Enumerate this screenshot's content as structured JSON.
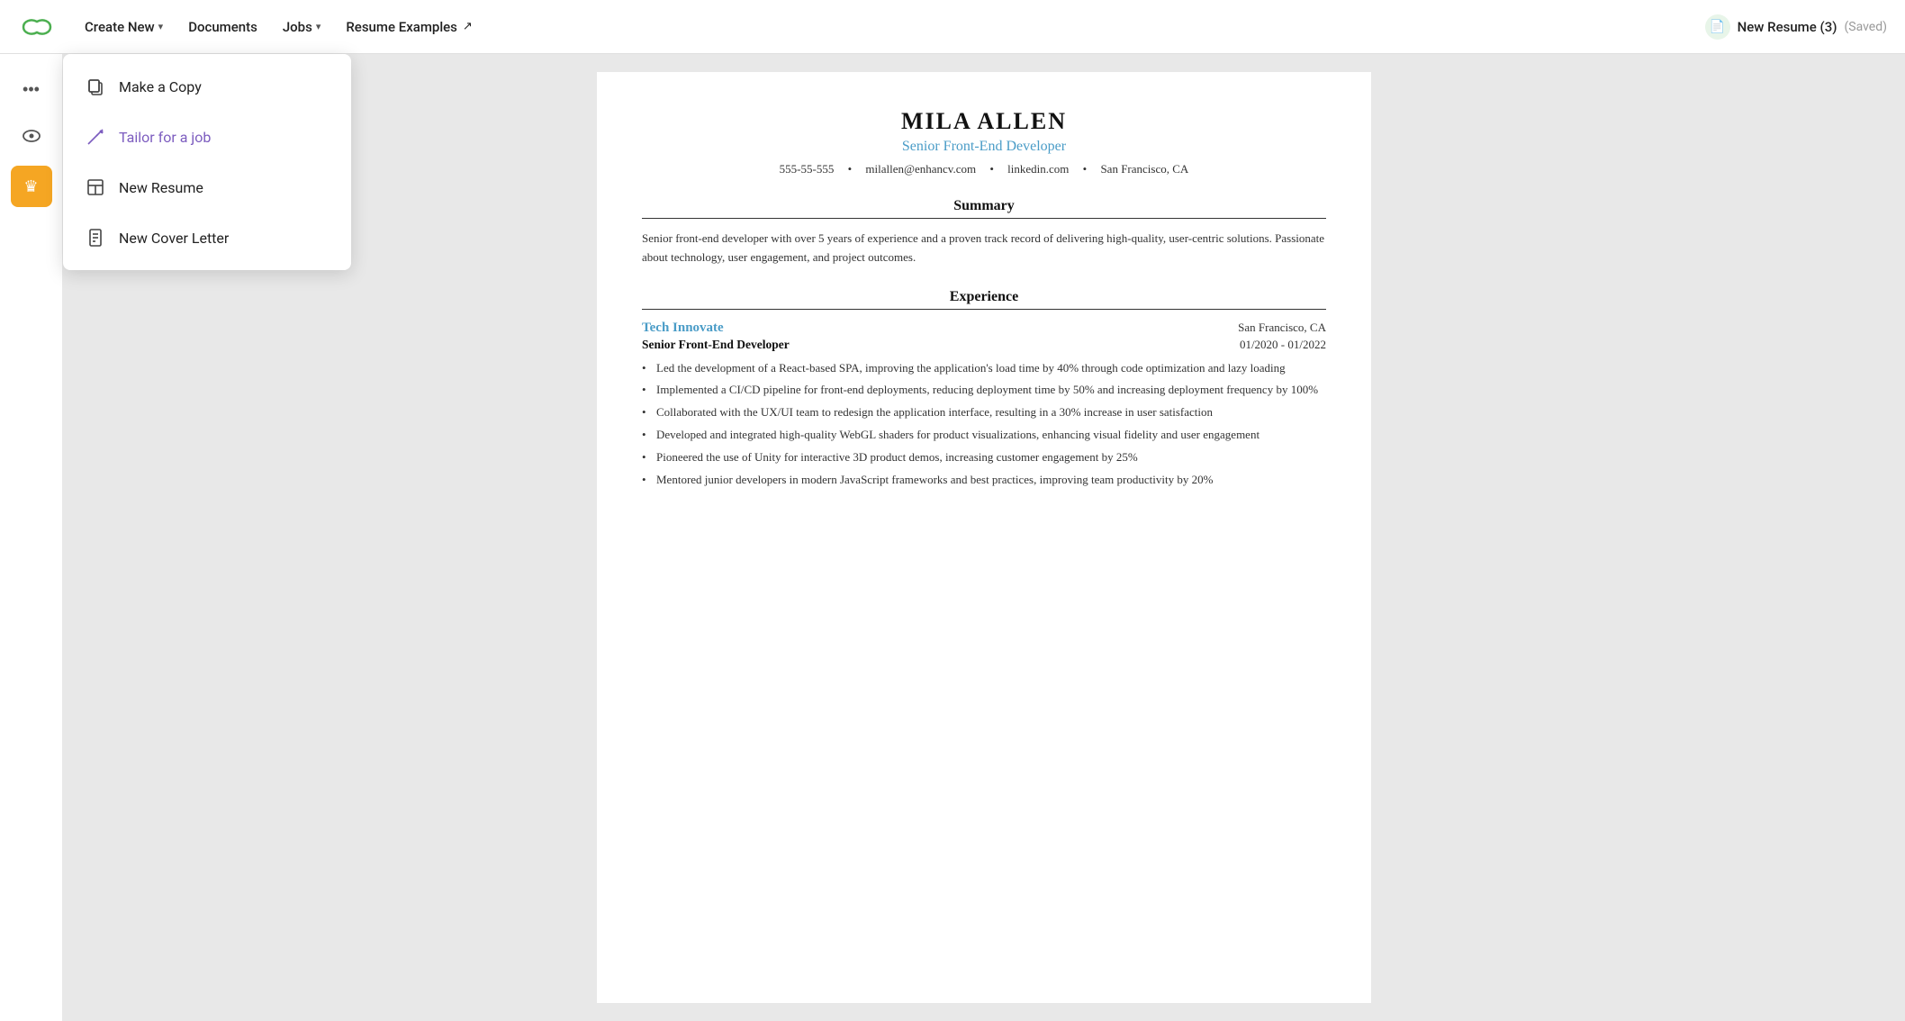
{
  "header": {
    "logo_alt": "Enhancv logo",
    "nav": [
      {
        "id": "create-new",
        "label": "Create New",
        "hasDropdown": true
      },
      {
        "id": "documents",
        "label": "Documents",
        "hasDropdown": false
      },
      {
        "id": "jobs",
        "label": "Jobs",
        "hasDropdown": true
      },
      {
        "id": "resume-examples",
        "label": "Resume Examples",
        "hasExternal": true
      }
    ],
    "resume_tab": {
      "name": "New Resume (3)",
      "saved_status": "(Saved)"
    }
  },
  "sidebar": {
    "buttons": [
      {
        "id": "more-options",
        "icon": "···",
        "label": "More options",
        "active": false
      },
      {
        "id": "preview",
        "icon": "👁",
        "label": "Preview",
        "active": false
      },
      {
        "id": "premium",
        "icon": "★",
        "label": "Premium",
        "active": true
      }
    ]
  },
  "dropdown": {
    "items": [
      {
        "id": "make-copy",
        "label": "Make a Copy",
        "icon": "copy",
        "highlighted": false
      },
      {
        "id": "tailor-job",
        "label": "Tailor for a job",
        "icon": "wand",
        "highlighted": true
      },
      {
        "id": "new-resume",
        "label": "New Resume",
        "icon": "layout",
        "highlighted": false
      },
      {
        "id": "new-cover-letter",
        "label": "New Cover Letter",
        "icon": "file-text",
        "highlighted": false
      }
    ]
  },
  "resume": {
    "name": "MILA ALLEN",
    "title": "Senior Front-End Developer",
    "contact": {
      "phone": "555-55-555",
      "email": "milallen@enhancv.com",
      "linkedin": "linkedin.com",
      "location": "San Francisco, CA"
    },
    "summary": {
      "heading": "Summary",
      "text": "Senior front-end developer with over 5 years of experience and a proven track record of delivering high-quality, user-centric solutions. Passionate about technology, user engagement, and project outcomes."
    },
    "experience": {
      "heading": "Experience",
      "entries": [
        {
          "company": "Tech Innovate",
          "location": "San Francisco, CA",
          "role": "Senior Front-End Developer",
          "dates": "01/2020 - 01/2022",
          "bullets": [
            "Led the development of a React-based SPA, improving the application's load time by 40% through code optimization and lazy loading",
            "Implemented a CI/CD pipeline for front-end deployments, reducing deployment time by 50% and increasing deployment frequency by 100%",
            "Collaborated with the UX/UI team to redesign the application interface, resulting in a 30% increase in user satisfaction",
            "Developed and integrated high-quality WebGL shaders for product visualizations, enhancing visual fidelity and user engagement",
            "Pioneered the use of Unity for interactive 3D product demos, increasing customer engagement by 25%",
            "Mentored junior developers in modern JavaScript frameworks and best practices, improving team productivity by 20%"
          ]
        }
      ]
    }
  }
}
